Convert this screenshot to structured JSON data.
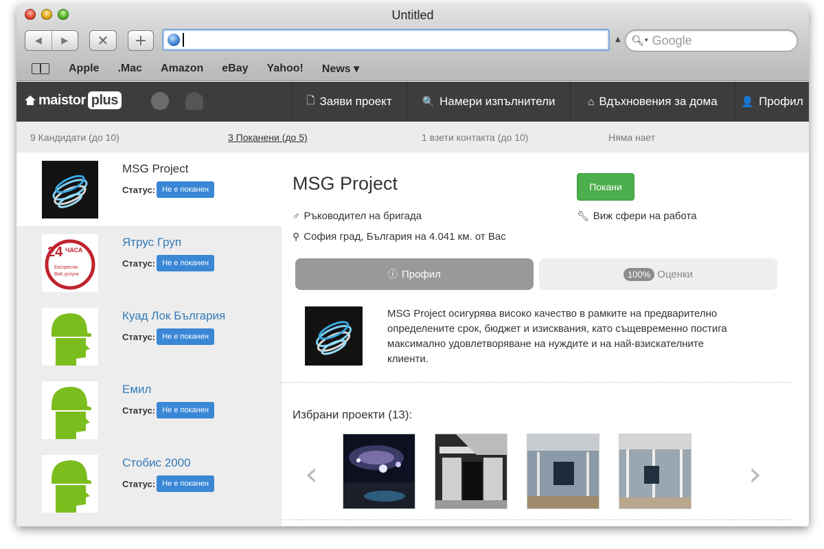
{
  "browser": {
    "title": "Untitled",
    "url_value": "",
    "search_placeholder": "Google",
    "nav_back_label": "◀",
    "nav_forward_label": "▶",
    "stop_label": "✕",
    "add_label": "+",
    "bookmarks": [
      "Apple",
      ".Mac",
      "Amazon",
      "eBay",
      "Yahoo!",
      "News ▾"
    ]
  },
  "site": {
    "logo_text": "maistor",
    "logo_plus": "plus",
    "nav": [
      {
        "label": "Заяви проект",
        "icon": "document-icon",
        "glyph": "🗋"
      },
      {
        "label": "Намери изпълнители",
        "icon": "search-icon",
        "glyph": "🔍"
      },
      {
        "label": "Вдъхновения за дома",
        "icon": "home-icon",
        "glyph": "⌂"
      },
      {
        "label": "Профил",
        "icon": "user-icon",
        "glyph": "👤"
      }
    ]
  },
  "stats": [
    "9 Кандидати (до 10)",
    "3 Поканени (до 5)",
    "1 взети контакта (до 10)",
    "Няма нает"
  ],
  "candidates": [
    {
      "name": "MSG Project",
      "status_label": "Статус:",
      "status": "Не е поканен"
    },
    {
      "name": "Ятрус Груп",
      "status_label": "Статус:",
      "status": "Не е поканен"
    },
    {
      "name": "Куад Лок България",
      "status_label": "Статус:",
      "status": "Не е поканен"
    },
    {
      "name": "Емил",
      "status_label": "Статус:",
      "status": "Не е поканен"
    },
    {
      "name": "Стобис 2000",
      "status_label": "Статус:",
      "status": "Не е поканен"
    }
  ],
  "logo24": {
    "num": "24",
    "word": "ЧАСА",
    "line1": "Експресни",
    "line2": "ВиК услуги"
  },
  "detail": {
    "title": "MSG Project",
    "invite_label": "Покани",
    "role": "Ръководител на бригада",
    "spheres": "Виж сфери на работа",
    "location": "София град, България на 4.041 км. от Вас",
    "tab_profile": "Профил",
    "tab_ratings_pct": "100%",
    "tab_ratings": "Оценки",
    "description": "MSG Project осигурява високо качество в рамките на предварително определените срок, бюджет и изисквания, като същевременно постига максимално удовлетворяване на нуждите и на най-взискателните клиенти.",
    "projects_title": "Избрани проекти (13):",
    "prev_arrow": "‹",
    "next_arrow": "›"
  },
  "colors": {
    "nav_bg": "#3d3d3d",
    "badge": "#3a87d6",
    "invite": "#4cae4c",
    "link": "#337ab7",
    "worker_green": "#7cbd1e"
  }
}
